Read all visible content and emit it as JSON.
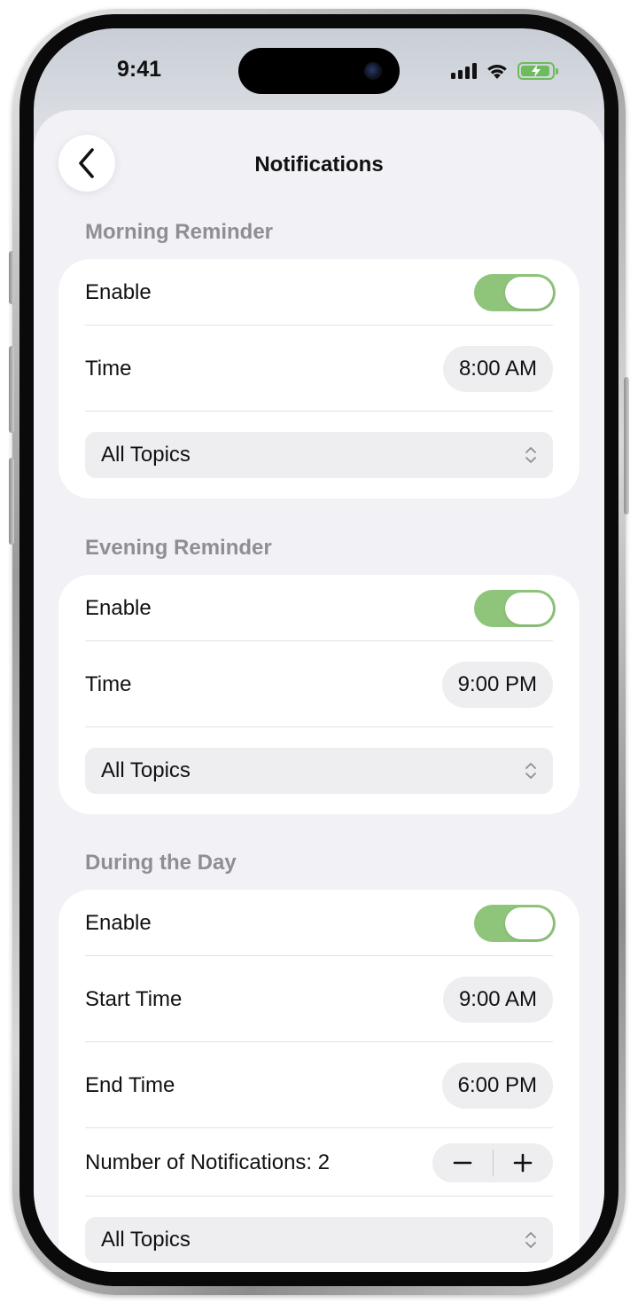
{
  "status_bar": {
    "time": "9:41"
  },
  "nav": {
    "title": "Notifications"
  },
  "sections": [
    {
      "header": "Morning Reminder",
      "enable_label": "Enable",
      "enabled": true,
      "time_label": "Time",
      "time_value": "8:00 AM",
      "topics": "All Topics"
    },
    {
      "header": "Evening Reminder",
      "enable_label": "Enable",
      "enabled": true,
      "time_label": "Time",
      "time_value": "9:00 PM",
      "topics": "All Topics"
    },
    {
      "header": "During the Day",
      "enable_label": "Enable",
      "enabled": true,
      "start_label": "Start Time",
      "start_value": "9:00 AM",
      "end_label": "End Time",
      "end_value": "6:00 PM",
      "count_label": "Number of Notifications: 2",
      "topics": "All Topics"
    }
  ],
  "colors": {
    "toggle_on": "#8fc57b",
    "battery": "#6dbb5c",
    "background": "#f1f1f6"
  },
  "icons": {
    "back": "chevron-left-icon",
    "picker": "chevron-up-down-icon",
    "minus": "minus-icon",
    "plus": "plus-icon",
    "signal": "cellular-signal-icon",
    "wifi": "wifi-icon",
    "battery": "battery-charging-icon"
  }
}
